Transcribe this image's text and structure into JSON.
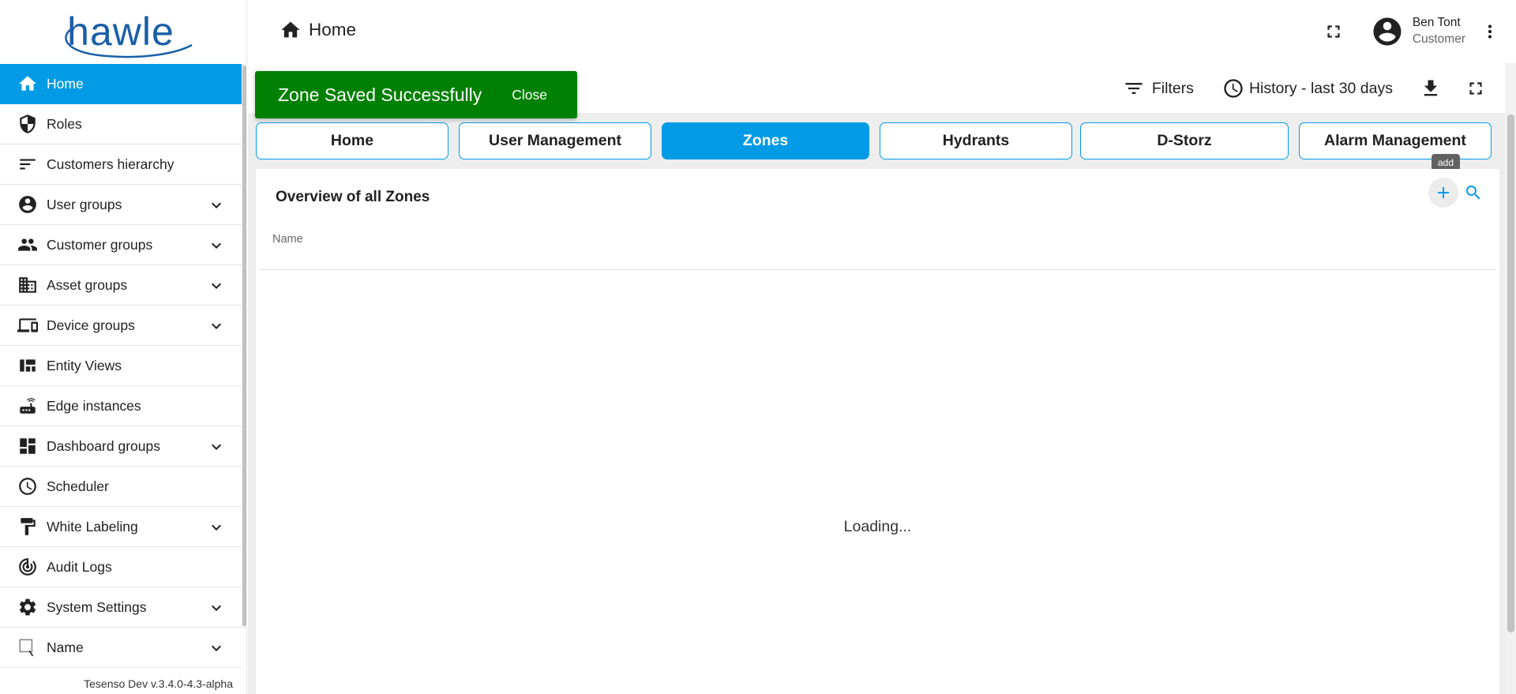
{
  "brand": {
    "logo_text": "hawle",
    "accent": "#039be5",
    "toast_color": "#008000"
  },
  "sidebar": {
    "items": [
      {
        "label": "Home",
        "icon": "home-icon",
        "active": true
      },
      {
        "label": "Roles",
        "icon": "shield-icon"
      },
      {
        "label": "Customers hierarchy",
        "icon": "sort-icon"
      },
      {
        "label": "User groups",
        "icon": "account-circle-icon",
        "expandable": true
      },
      {
        "label": "Customer groups",
        "icon": "people-icon",
        "expandable": true
      },
      {
        "label": "Asset groups",
        "icon": "domain-icon",
        "expandable": true
      },
      {
        "label": "Device groups",
        "icon": "devices-icon",
        "expandable": true
      },
      {
        "label": "Entity Views",
        "icon": "view-quilt-icon"
      },
      {
        "label": "Edge instances",
        "icon": "router-icon"
      },
      {
        "label": "Dashboard groups",
        "icon": "dashboard-icon",
        "expandable": true
      },
      {
        "label": "Scheduler",
        "icon": "schedule-icon"
      },
      {
        "label": "White Labeling",
        "icon": "format-paint-icon",
        "expandable": true
      },
      {
        "label": "Audit Logs",
        "icon": "track-changes-icon"
      },
      {
        "label": "System Settings",
        "icon": "settings-icon",
        "expandable": true
      },
      {
        "label": "Name",
        "icon": "broken-image-icon",
        "expandable": true
      }
    ],
    "version": "Tesenso Dev v.3.4.0-4.3-alpha"
  },
  "header": {
    "title": "Home",
    "user": {
      "name": "Ben Tont",
      "role": "Customer"
    }
  },
  "toolbar": {
    "filters_label": "Filters",
    "history_label": "History - last 30 days"
  },
  "toast": {
    "message": "Zone Saved Successfully",
    "close_label": "Close"
  },
  "dashboard": {
    "tabs": [
      {
        "label": "Home"
      },
      {
        "label": "User Management"
      },
      {
        "label": "Zones",
        "active": true
      },
      {
        "label": "Hydrants"
      },
      {
        "label": "D-Storz"
      },
      {
        "label": "Alarm Management"
      }
    ],
    "tooltip": "add",
    "card": {
      "title": "Overview of all Zones",
      "column_header": "Name",
      "loading_text": "Loading..."
    }
  }
}
